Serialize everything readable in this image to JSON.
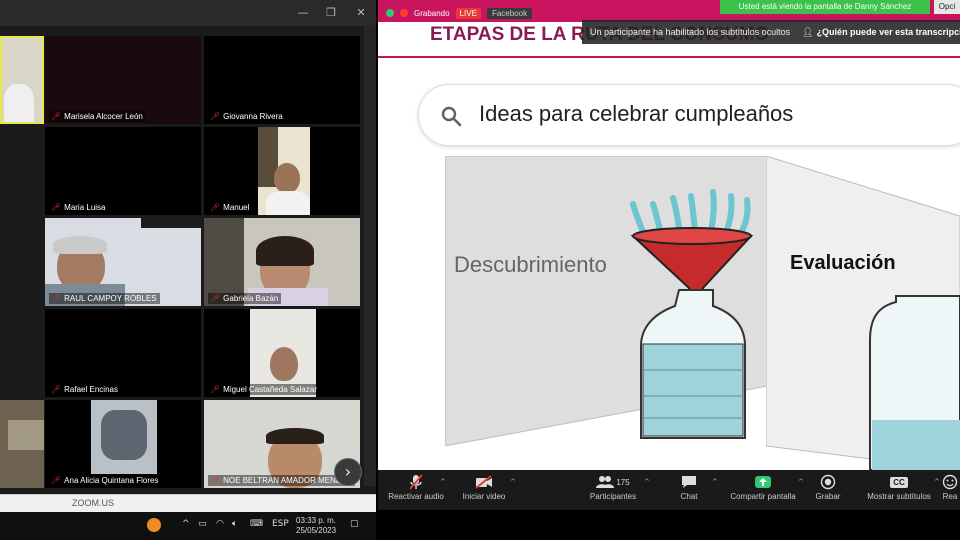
{
  "gallery": {
    "participants": [
      {
        "name": ""
      },
      {
        "name": "Marisela Alcocer León"
      },
      {
        "name": "Giovanna Rivera"
      },
      {
        "name": ""
      },
      {
        "name": "Maria Luisa"
      },
      {
        "name": "Manuel"
      },
      {
        "name": ""
      },
      {
        "name": "RAUL CAMPOY ROBLES"
      },
      {
        "name": "Gabriela Bazán"
      },
      {
        "name": ""
      },
      {
        "name": "Rafael Encinas"
      },
      {
        "name": "Miguel Castañeda Salazar"
      },
      {
        "name": ""
      },
      {
        "name": "Ana Alicia Quintana Flores"
      },
      {
        "name": "NOE BELTRAN AMADOR MENDEZ"
      }
    ],
    "next_page_icon": "chevron-right-icon"
  },
  "taskbar": {
    "zoom_label": "ZOOM.US",
    "language": "ESP",
    "time": "03:33 p. m.",
    "date": "25/05/2023"
  },
  "meeting": {
    "recording_label": "Grabando",
    "live_badge": "LIVE",
    "facebook_label": "Facebook",
    "viewing_banner": "Usted está viendo la pantalla de Danny Sánchez",
    "options_label": "Opci",
    "notice_text": "Un participante ha habilitado los subtítulos ocultos",
    "notice_link": "¿Quién puede ver esta transcripció"
  },
  "slide": {
    "title": "ETAPAS DE LA RUTA DEL CONSUMO",
    "search_query": "Ideas para celebrar cumpleaños",
    "stage_1": "Descubrimiento",
    "stage_2": "Evaluación"
  },
  "toolbar": {
    "items": [
      {
        "label": "Reactivar audio",
        "icon": "microphone-muted-icon"
      },
      {
        "label": "Iniciar video",
        "icon": "video-off-icon"
      },
      {
        "label": "Participantes",
        "icon": "participants-icon",
        "count": "175"
      },
      {
        "label": "Chat",
        "icon": "chat-icon"
      },
      {
        "label": "Compartir pantalla",
        "icon": "share-screen-icon"
      },
      {
        "label": "Grabar",
        "icon": "record-icon"
      },
      {
        "label": "Mostrar subtítulos",
        "icon": "cc-icon"
      },
      {
        "label": "Rea",
        "icon": "reactions-icon"
      }
    ]
  },
  "colors": {
    "brand_pink": "#c9145f",
    "title_text": "#8a1a56",
    "share_green": "#3cc14b",
    "mic_red": "#e0352b"
  }
}
